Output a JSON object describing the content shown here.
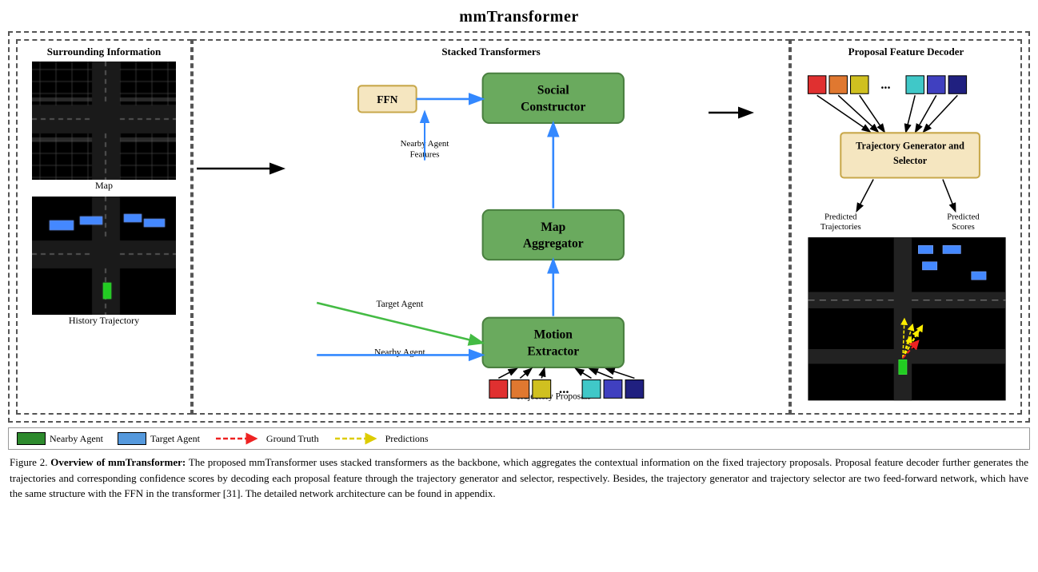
{
  "title": "mmTransformer",
  "panels": {
    "surrounding": {
      "title": "Surrounding Information",
      "map_label": "Map",
      "trajectory_label": "History Trajectory"
    },
    "stacked": {
      "title": "Stacked Transformers",
      "social_constructor": "Social\nConstructor",
      "map_aggregator": "Map\nAggregator",
      "motion_extractor": "Motion\nExtractor",
      "ffn_label": "FFN",
      "nearby_agent_features": "Nearby Agent\nFeatures",
      "target_agent_label": "Target Agent",
      "nearby_agent_label": "Nearby Agent",
      "trajectory_proposals_label": "Trajectory Proposals"
    },
    "proposal": {
      "title": "Proposal Feature Decoder",
      "trajectory_generator": "Trajectory Generator and\nSelector",
      "predicted_trajectories": "Predicted Trajectories",
      "predicted_scores": "Predicted Scores"
    }
  },
  "legend": {
    "nearby_agent_label": "Nearby Agent",
    "target_agent_label": "Target Agent",
    "ground_truth_label": "Ground Truth",
    "predictions_label": "Predictions"
  },
  "caption": {
    "figure_label": "Figure 2.",
    "bold_part": "Overview of mmTransformer:",
    "text": " The proposed mmTransformer uses stacked transformers as the backbone, which aggregates the contextual information on the fixed trajectory proposals. Proposal feature decoder further generates the trajectories and corresponding confidence scores by decoding each proposal feature through the trajectory generator and selector, respectively.  Besides, the trajectory generator and trajectory selector are two feed-forward network, which have the same structure with the FFN in the transformer [31]. The detailed network architecture can be found in appendix."
  },
  "colors": {
    "green_box": "#6aaa5e",
    "tan_box": "#f5e6c0",
    "proposal_red": "#e03030",
    "proposal_orange": "#e07830",
    "proposal_yellow": "#d0c020",
    "proposal_cyan": "#40c8c8",
    "proposal_blue": "#4040c0",
    "proposal_darkblue": "#202080",
    "arrow_black": "#000000",
    "arrow_blue": "#3388ff",
    "arrow_green": "#44aa44"
  }
}
